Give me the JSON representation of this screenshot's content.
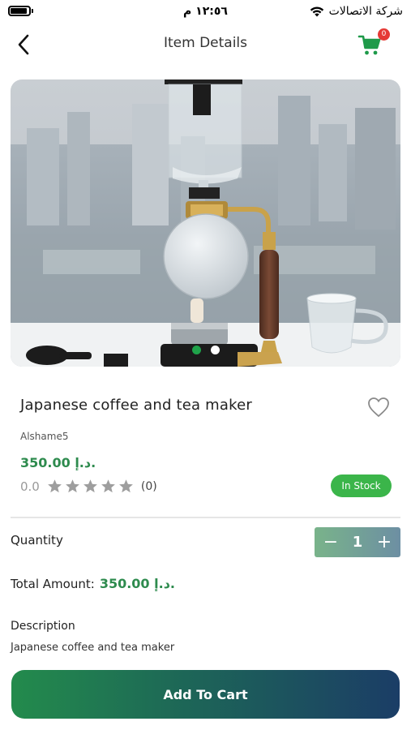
{
  "status_bar": {
    "time": "١٢:٥٦ م",
    "carrier": "شركة الاتصالات"
  },
  "header": {
    "title": "Item Details",
    "cart_count": "0"
  },
  "image": {
    "slides": 2,
    "active_slide": 1
  },
  "product": {
    "name": "Japanese coffee and tea maker",
    "seller": "Alshame5",
    "price": "350.00 د.إ.",
    "rating_value": "0.0",
    "rating": 0,
    "max_rating": 5,
    "review_count": "(0)",
    "stock_status": "In Stock"
  },
  "quantity": {
    "label": "Quantity",
    "value": "1",
    "decrement": "−",
    "increment": "+"
  },
  "total": {
    "label": "Total Amount:",
    "value": "350.00 د.إ."
  },
  "description": {
    "label": "Description",
    "text": "Japanese coffee and tea maker"
  },
  "actions": {
    "add_to_cart": "Add To Cart"
  },
  "colors": {
    "brand_green": "#2e8b4e",
    "stock_green": "#3bb54a",
    "badge_red": "#e53935",
    "button_gradient_start": "#238b4c",
    "button_gradient_end": "#1b3d66"
  },
  "icons": [
    "battery-icon",
    "wifi-icon",
    "back-arrow-icon",
    "cart-icon",
    "heart-icon",
    "star-icon"
  ]
}
